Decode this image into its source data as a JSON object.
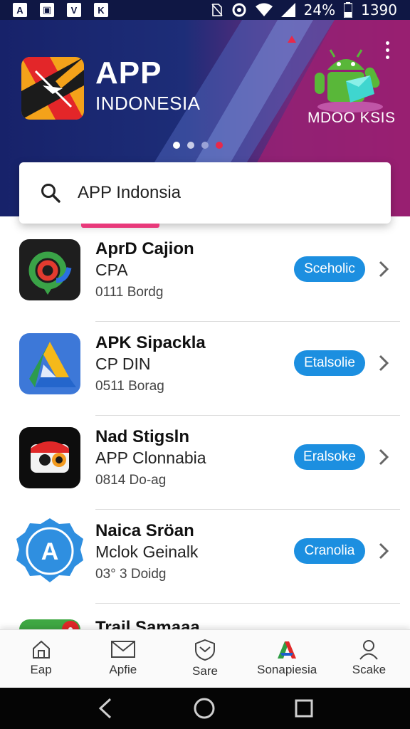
{
  "status_bar": {
    "notif_icons": [
      "A",
      "▣",
      "V",
      "K"
    ],
    "battery": "24%",
    "time": "1390"
  },
  "header": {
    "app_title": "APP",
    "app_subtitle": "INDONESIA",
    "promo_label": "MDOO KSIS",
    "pager_count": 4,
    "pager_active": 0,
    "colors": {
      "accent": "#e8294a",
      "banner_dark": "#17226a",
      "banner_magenta": "#8e1f6f"
    }
  },
  "search": {
    "value": "APP Indonsia"
  },
  "apps": [
    {
      "name": "AprD Cajion",
      "developer": "CPA",
      "meta": "0111 Bordg",
      "action": "Sceholic",
      "icon": "maps-pin-icon"
    },
    {
      "name": "APK Sipackla",
      "developer": "CP DIN",
      "meta": "0511 Borag",
      "action": "Etalsolie",
      "icon": "drive-icon"
    },
    {
      "name": "Nad Stigsln",
      "developer": "APP Clonnabia",
      "meta": "0814 Do-ag",
      "action": "Eralsoke",
      "icon": "owl-icon"
    },
    {
      "name": "Naica Sröan",
      "developer": "Mclok Geinalk",
      "meta": "03° 3 Doidg",
      "action": "Cranolia",
      "icon": "badge-a-icon"
    },
    {
      "name": "Trail Samaaa",
      "developer": "",
      "meta": "",
      "action": "",
      "icon": "green-app-icon"
    }
  ],
  "bottom_nav": [
    {
      "label": "Eap",
      "icon": "home-icon"
    },
    {
      "label": "Apfie",
      "icon": "mail-icon"
    },
    {
      "label": "Sare",
      "icon": "shield-icon"
    },
    {
      "label": "Sonapiesia",
      "icon": "app-logo-icon"
    },
    {
      "label": "Scake",
      "icon": "person-icon"
    }
  ],
  "system_nav": [
    "back-icon",
    "home-circle-icon",
    "recents-icon"
  ]
}
